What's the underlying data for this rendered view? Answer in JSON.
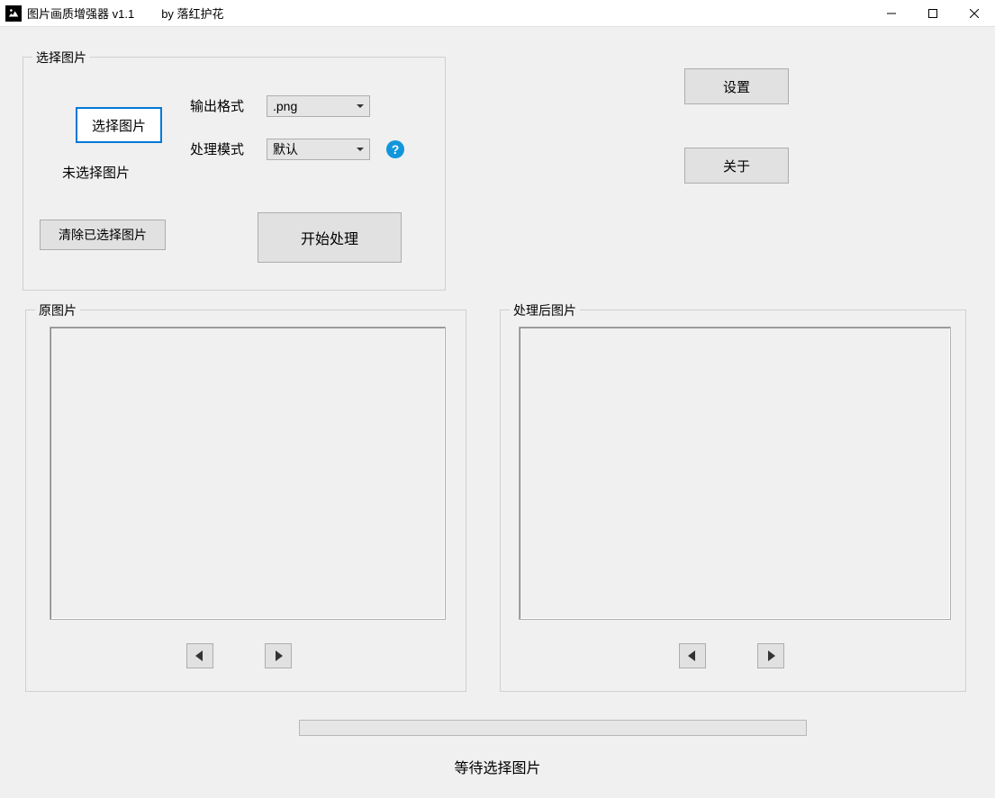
{
  "titlebar": {
    "title": "图片画质增强器 v1.1",
    "author": "by 落红护花"
  },
  "groupSelect": {
    "title": "选择图片",
    "selectButton": "选择图片",
    "noSelection": "未选择图片",
    "outputFormatLabel": "输出格式",
    "outputFormatValue": ".png",
    "processModeLabel": "处理模式",
    "processModeValue": "默认",
    "clearButton": "清除已选择图片",
    "startButton": "开始处理"
  },
  "sideButtons": {
    "settings": "设置",
    "about": "关于"
  },
  "groupOriginal": {
    "title": "原图片"
  },
  "groupProcessed": {
    "title": "处理后图片"
  },
  "status": "等待选择图片"
}
